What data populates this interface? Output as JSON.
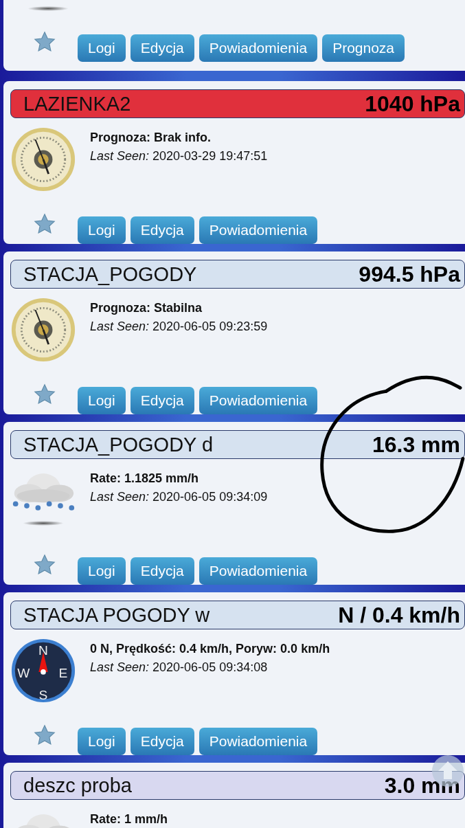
{
  "devices": [
    {
      "kind": "rain",
      "buttons": [
        "Logi",
        "Edycja",
        "Powiadomienia",
        "Prognoza"
      ]
    },
    {
      "title": "LAZIENKA2",
      "value": "1040 hPa",
      "color": "#e0303c",
      "kind": "barometer",
      "info": "Prognoza: Brak info.",
      "last_seen": "*Last Seen:* 2020-03-29 19:47:51",
      "buttons": [
        "Logi",
        "Edycja",
        "Powiadomienia"
      ]
    },
    {
      "title": "STACJA_POGODY",
      "value": "994.5 hPa",
      "color": "#d6e2f0",
      "kind": "barometer",
      "info": "Prognoza: Stabilna",
      "last_seen": "*Last Seen:* 2020-06-05 09:23:59",
      "buttons": [
        "Logi",
        "Edycja",
        "Powiadomienia"
      ]
    },
    {
      "title": "STACJA_POGODY d",
      "value": "16.3 mm",
      "color": "#d6e2f0",
      "kind": "rain",
      "info": "Rate: 1.1825 mm/h",
      "last_seen": "*Last Seen:* 2020-06-05 09:34:09",
      "buttons": [
        "Logi",
        "Edycja",
        "Powiadomienia"
      ]
    },
    {
      "title": "STACJA POGODY w",
      "value": "N / 0.4 km/h",
      "color": "#d6e2f0",
      "kind": "compass",
      "compass_letters": [
        "N",
        "W",
        "E",
        "S"
      ],
      "info": "0 N, Prędkość: 0.4 km/h, Poryw: 0.0 km/h",
      "last_seen": "*Last Seen:* 2020-06-05 09:34:08",
      "buttons": [
        "Logi",
        "Edycja",
        "Powiadomienia"
      ]
    },
    {
      "title": "deszc proba",
      "value": "3.0 mm",
      "color": "#d8d8f0",
      "kind": "rain",
      "info": "Rate: 1 mm/h"
    }
  ]
}
